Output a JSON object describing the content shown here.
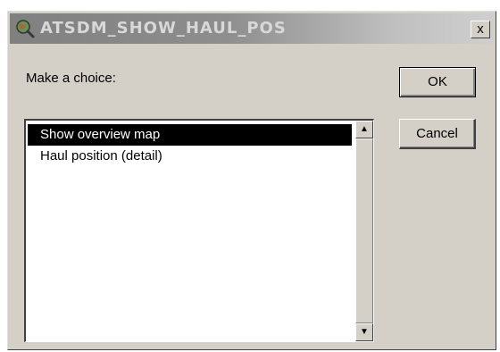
{
  "window": {
    "title": "ATSDM_SHOW_HAUL_POS",
    "close_label": "x"
  },
  "prompt": "Make a choice:",
  "buttons": {
    "ok": "OK",
    "cancel": "Cancel"
  },
  "list": {
    "items": [
      {
        "label": "Show overview map",
        "selected": true
      },
      {
        "label": "Haul position (detail)",
        "selected": false
      }
    ]
  },
  "scrollbar": {
    "up_arrow": "▲",
    "down_arrow": "▼"
  },
  "icons": {
    "app": "globe-magnifier-icon"
  }
}
